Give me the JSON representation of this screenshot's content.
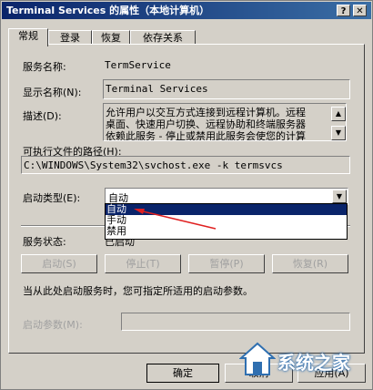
{
  "window": {
    "title": "Terminal Services 的属性（本地计算机）",
    "help_btn": "?",
    "close_btn": "✕"
  },
  "tabs": [
    {
      "label": "常规",
      "active": true
    },
    {
      "label": "登录"
    },
    {
      "label": "恢复"
    },
    {
      "label": "依存关系"
    }
  ],
  "general": {
    "service_name_label": "服务名称:",
    "service_name_value": "TermService",
    "display_name_label": "显示名称(N):",
    "display_name_value": "Terminal Services",
    "description_label": "描述(D):",
    "description_lines": [
      "允许用户以交互方式连接到远程计算机。远程",
      "桌面、快速用户切换、远程协助和终端服务器",
      "依赖此服务 - 停止或禁用此服务会使您的计算"
    ],
    "exe_path_label": "可执行文件的路径(H):",
    "exe_path_value": "C:\\WINDOWS\\System32\\svchost.exe -k termsvcs",
    "startup_type_label": "启动类型(E):",
    "startup_type_value": "自动",
    "startup_options": [
      "自动",
      "手动",
      "禁用"
    ],
    "service_status_label": "服务状态:",
    "service_status_value": "已启动",
    "start_btn": "启动(S)",
    "stop_btn": "停止(T)",
    "pause_btn": "暂停(P)",
    "resume_btn": "恢复(R)",
    "hint_text": "当从此处启动服务时，您可指定所适用的启动参数。",
    "start_params_label": "启动参数(M):"
  },
  "footer": {
    "ok_btn": "确定",
    "cancel_btn": "取消",
    "apply_btn": "应用(A)"
  },
  "watermark": "系统之家",
  "colors": {
    "titlebar_start": "#0a246a",
    "titlebar_end": "#3a6ea5",
    "face": "#d4d0c8",
    "selection": "#0a246a",
    "annotation_arrow": "#e02020"
  }
}
